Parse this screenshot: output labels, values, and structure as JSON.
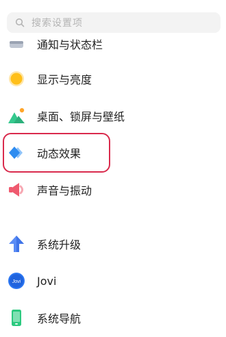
{
  "search": {
    "placeholder": "搜索设置项"
  },
  "items": [
    {
      "label": "通知与状态栏",
      "icon": "notification-icon"
    },
    {
      "label": "显示与亮度",
      "icon": "brightness-sun-icon"
    },
    {
      "label": "桌面、锁屏与壁纸",
      "icon": "wallpaper-mountain-icon"
    },
    {
      "label": "动态效果",
      "icon": "motion-effects-diamond-icon"
    },
    {
      "label": "声音与振动",
      "icon": "speaker-icon"
    },
    {
      "label": "系统升级",
      "icon": "arrow-up-icon"
    },
    {
      "label": "Jovi",
      "icon": "jovi-icon"
    },
    {
      "label": "系统导航",
      "icon": "phone-navigation-icon"
    }
  ],
  "colors": {
    "highlight": "#d92a4c",
    "sun": "#ffbf1a",
    "mountain": "#35c98e",
    "diamond": "#2e8cf0",
    "speaker": "#ef5a6f",
    "arrow": "#5a8cf5",
    "jovi": "#2c77f2",
    "phone": "#2cc97f"
  }
}
